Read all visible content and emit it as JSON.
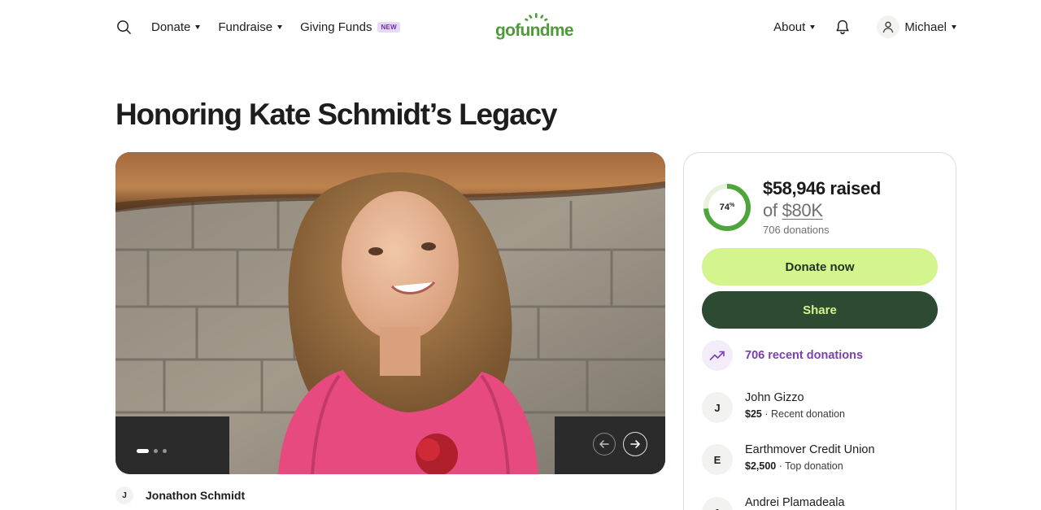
{
  "header": {
    "nav_left": {
      "donate": "Donate",
      "fundraise": "Fundraise",
      "giving_funds": "Giving Funds",
      "new_badge": "NEW"
    },
    "logo_text": "gofundme",
    "nav_right": {
      "about": "About",
      "user": "Michael"
    }
  },
  "page_title": "Honoring Kate Schmidt’s Legacy",
  "media": {
    "slide_count": 3,
    "active_slide": 1
  },
  "organizer": {
    "initial": "J",
    "name": "Jonathon Schmidt"
  },
  "summary": {
    "progress_value": "74",
    "progress_unit": "%",
    "progress_fraction": 0.74,
    "raised": "$58,946 raised",
    "goal_prefix": "of",
    "goal": "$80K",
    "donations": "706 donations",
    "donate_button": "Donate now",
    "share_button": "Share",
    "recent_label": "706 recent donations"
  },
  "donors": [
    {
      "initial": "J",
      "name": "John Gizzo",
      "amount": "$25",
      "note": " · Recent donation"
    },
    {
      "initial": "E",
      "name": "Earthmover Credit Union",
      "amount": "$2,500",
      "note": " · Top donation"
    },
    {
      "initial": "A",
      "name": "Andrei Plamadeala",
      "amount": "",
      "note": ""
    }
  ],
  "colors": {
    "brand_green": "#4f9a3a",
    "donate_bg": "#d4f48e",
    "share_bg": "#2d4a32",
    "accent_purple": "#7b3fb0"
  }
}
